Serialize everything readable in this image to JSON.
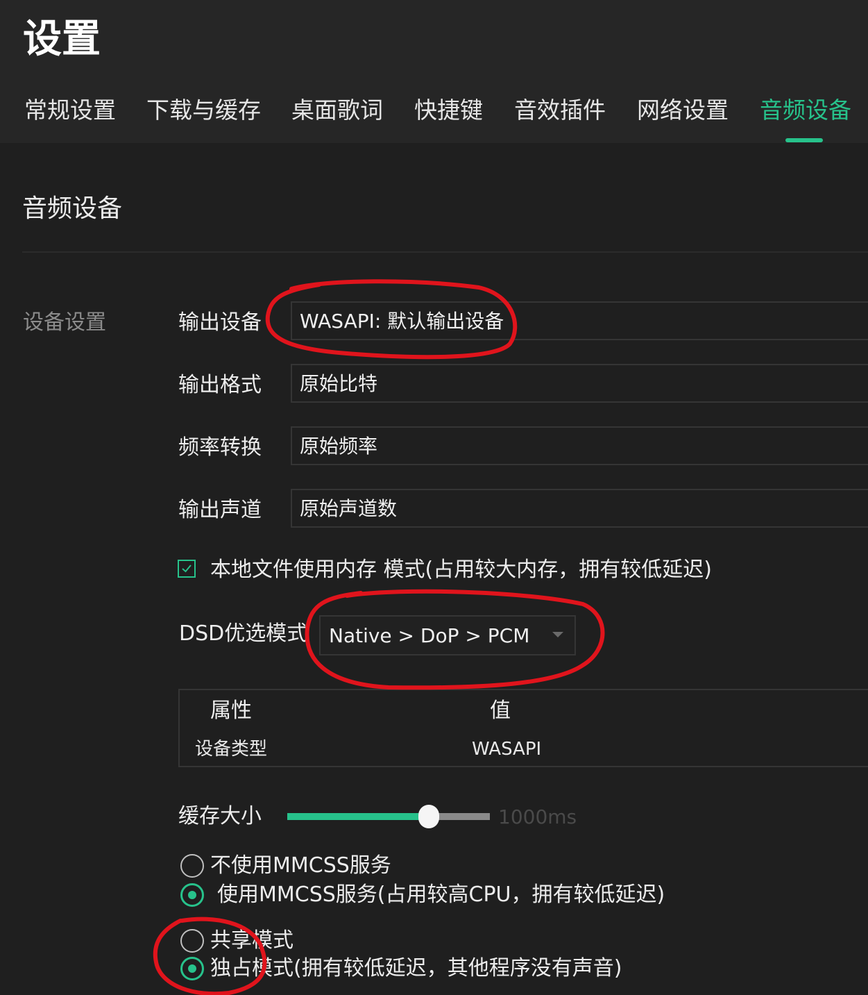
{
  "header": {
    "title": "设置",
    "tabs": [
      {
        "label": "常规设置",
        "active": false
      },
      {
        "label": "下载与缓存",
        "active": false
      },
      {
        "label": "桌面歌词",
        "active": false
      },
      {
        "label": "快捷键",
        "active": false
      },
      {
        "label": "音效插件",
        "active": false
      },
      {
        "label": "网络设置",
        "active": false
      },
      {
        "label": "音频设备",
        "active": true
      }
    ]
  },
  "section": {
    "title": "音频设备",
    "group_label": "设备设置"
  },
  "fields": [
    {
      "label": "输出设备",
      "value": "WASAPI: 默认输出设备"
    },
    {
      "label": "输出格式",
      "value": "原始比特"
    },
    {
      "label": "频率转换",
      "value": "原始频率"
    },
    {
      "label": "输出声道",
      "value": "原始声道数"
    }
  ],
  "memory_mode": {
    "checked": true,
    "label": "本地文件使用内存 模式(占用较大内存，拥有较低延迟)"
  },
  "dsd": {
    "label": "DSD优选模式",
    "selected": "Native > DoP > PCM"
  },
  "properties": {
    "headers": [
      "属性",
      "值"
    ],
    "rows": [
      [
        "设备类型",
        "WASAPI"
      ]
    ]
  },
  "buffer": {
    "label": "缓存大小",
    "value_text": "1000ms",
    "fraction": 0.7
  },
  "mmcss": {
    "options": [
      {
        "label": "不使用MMCSS服务",
        "selected": false
      },
      {
        "label": "使用MMCSS服务(占用较高CPU，拥有较低延迟)",
        "selected": true
      }
    ]
  },
  "share_mode": {
    "options": [
      {
        "label": "共享模式",
        "selected": false
      },
      {
        "label": "独占模式(拥有较低延迟，其他程序没有声音)",
        "selected": true
      }
    ]
  },
  "colors": {
    "accent": "#27c28b",
    "background": "#1f1f1f",
    "header_background": "#262626",
    "annotation": "#e0141c"
  }
}
